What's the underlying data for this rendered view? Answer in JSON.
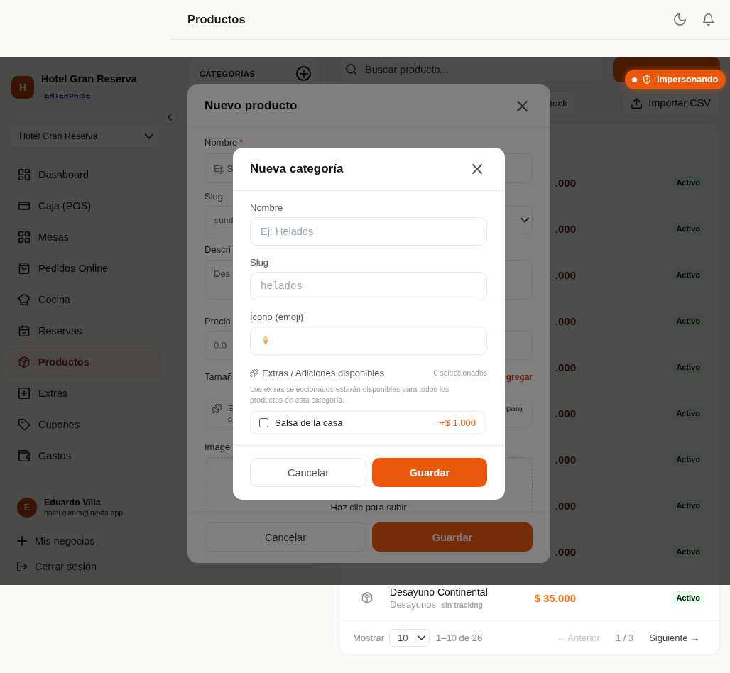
{
  "header": {
    "title": "Productos"
  },
  "sidebar": {
    "business": {
      "initial": "H",
      "name": "Hotel Gran Reserva",
      "plan": "ENTERPRISE"
    },
    "business_select": {
      "value": "Hotel Gran Reserva"
    },
    "nav": [
      {
        "label": "Dashboard",
        "selected": false
      },
      {
        "label": "Caja (POS)",
        "selected": false
      },
      {
        "label": "Mesas",
        "selected": false
      },
      {
        "label": "Pedidos Online",
        "selected": false
      },
      {
        "label": "Cocina",
        "selected": false
      },
      {
        "label": "Reservas",
        "selected": false
      },
      {
        "label": "Productos",
        "selected": true
      },
      {
        "label": "Extras",
        "selected": false
      },
      {
        "label": "Cupones",
        "selected": false
      },
      {
        "label": "Gastos",
        "selected": false
      }
    ],
    "user": {
      "initial": "E",
      "name": "Eduardo Villa",
      "email": "hotel.owner@nexta.app"
    },
    "actions": [
      {
        "kind": "add",
        "label": "Mis negocios"
      },
      {
        "kind": "logout",
        "label": "Cerrar sesión"
      }
    ]
  },
  "categories_panel": {
    "title": "CATEGORÍAS"
  },
  "toolbar": {
    "search": {
      "placeholder": "Buscar producto..."
    },
    "stock_button": {
      "label": "tock"
    },
    "import_button": {
      "label": "Importar CSV"
    }
  },
  "products_table": {
    "rows": [
      {
        "price": ".000",
        "status": "Activo"
      },
      {
        "price": ".000",
        "status": "Activo"
      },
      {
        "price": ".000",
        "status": "Activo"
      },
      {
        "price": ".000",
        "status": "Activo"
      },
      {
        "price": ".000",
        "status": "Activo"
      },
      {
        "price": ".000",
        "status": "Activo"
      },
      {
        "price": ".000",
        "status": "Activo"
      },
      {
        "price": ".000",
        "status": "Activo"
      },
      {
        "price": ".000",
        "status": "Activo"
      },
      {
        "name": "Desayuno Continental",
        "category": "Desayunos",
        "tracking": "sin tracking",
        "price": "$ 35.000",
        "status": "Activo"
      }
    ],
    "pagination": {
      "label": "Mostrar",
      "page_size": "10",
      "range": "1–10 de 26",
      "previous": {
        "label": "← Anterior",
        "disabled": true
      },
      "page": "1 / 3",
      "next": {
        "label": "Siguiente →",
        "disabled": false
      }
    }
  },
  "product_modal": {
    "title": "Nuevo producto",
    "name_field": {
      "label": "Nombre",
      "required_mark": "*",
      "placeholder": "Ej: S"
    },
    "slug_field": {
      "label": "Slug",
      "placeholder": "sund"
    },
    "description_field": {
      "label": "Descri",
      "placeholder": "Des"
    },
    "price_field": {
      "label": "Precio",
      "placeholder": "0.0"
    },
    "sizes": {
      "label": "Tamañ",
      "add_link": "gregar"
    },
    "sizes_note": {
      "lines_start": [
        "E",
        "c"
      ],
      "line_end": "para"
    },
    "image_field": {
      "label": "Image",
      "hint": "Haz clic para subir"
    },
    "buttons": [
      {
        "kind": "secondary",
        "label": "Cancelar"
      },
      {
        "kind": "primary",
        "label": "Guardar"
      }
    ]
  },
  "category_modal": {
    "title": "Nueva categoría",
    "fields": [
      {
        "kind": "text",
        "label": "Nombre",
        "placeholder": "Ej: Helados"
      },
      {
        "kind": "mono",
        "label": "Slug",
        "placeholder": "helados"
      },
      {
        "kind": "emoji",
        "label": "Ícono (emoji)"
      }
    ],
    "extras": {
      "title": "Extras / Adiciones disponibles",
      "count": "0 seleccionados",
      "help": "Los extras seleccionados estarán disponibles para todos los productos de esta categoría.",
      "items": [
        {
          "name": "Salsa de la casa",
          "price": "+$ 1.000",
          "checked": false
        }
      ]
    },
    "buttons": [
      {
        "kind": "secondary",
        "label": "Cancelar"
      },
      {
        "kind": "primary",
        "label": "Guardar"
      }
    ]
  },
  "impersonation_badge": {
    "label": "Impersonando"
  }
}
